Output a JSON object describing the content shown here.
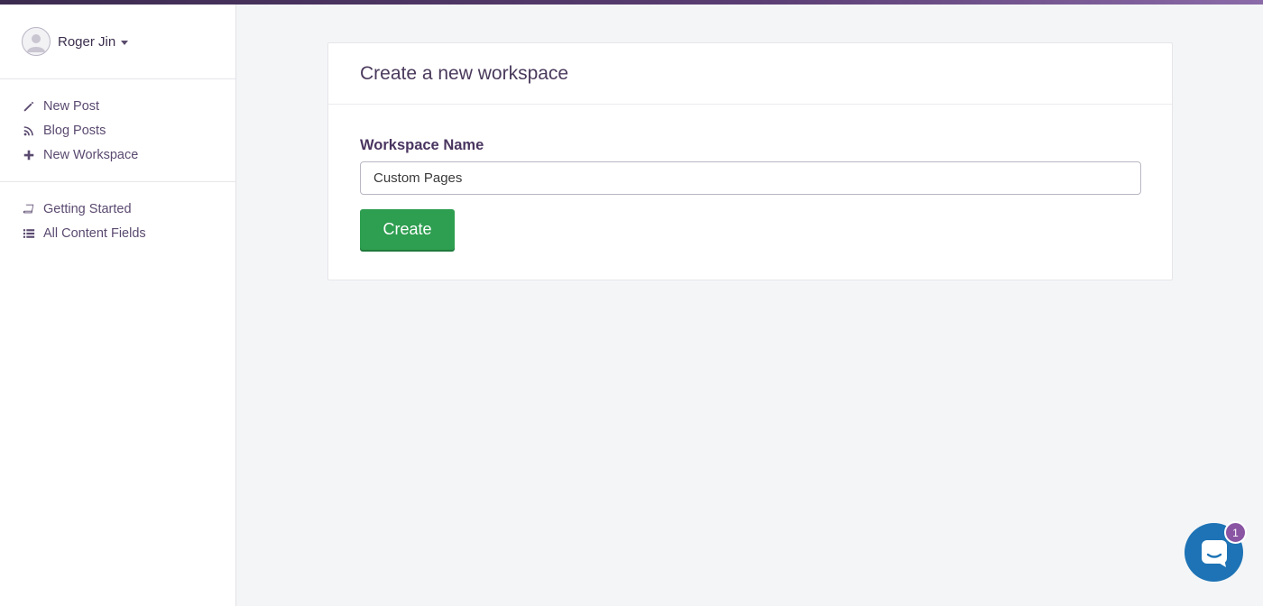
{
  "user": {
    "name": "Roger Jin"
  },
  "nav_primary": [
    {
      "label": "New Post",
      "icon": "pencil-icon"
    },
    {
      "label": "Blog Posts",
      "icon": "rss-icon"
    },
    {
      "label": "New Workspace",
      "icon": "plus-icon"
    }
  ],
  "nav_secondary": [
    {
      "label": "Getting Started",
      "icon": "book-icon"
    },
    {
      "label": "All Content Fields",
      "icon": "list-icon"
    }
  ],
  "card": {
    "title": "Create a new workspace",
    "field_label": "Workspace Name",
    "input_value": "Custom Pages",
    "button_label": "Create"
  },
  "chat": {
    "badge_count": "1"
  },
  "colors": {
    "accent": "#5b4a70",
    "create_button": "#2e9e50",
    "chat_launcher": "#1d73b5",
    "badge": "#8a55a3"
  }
}
